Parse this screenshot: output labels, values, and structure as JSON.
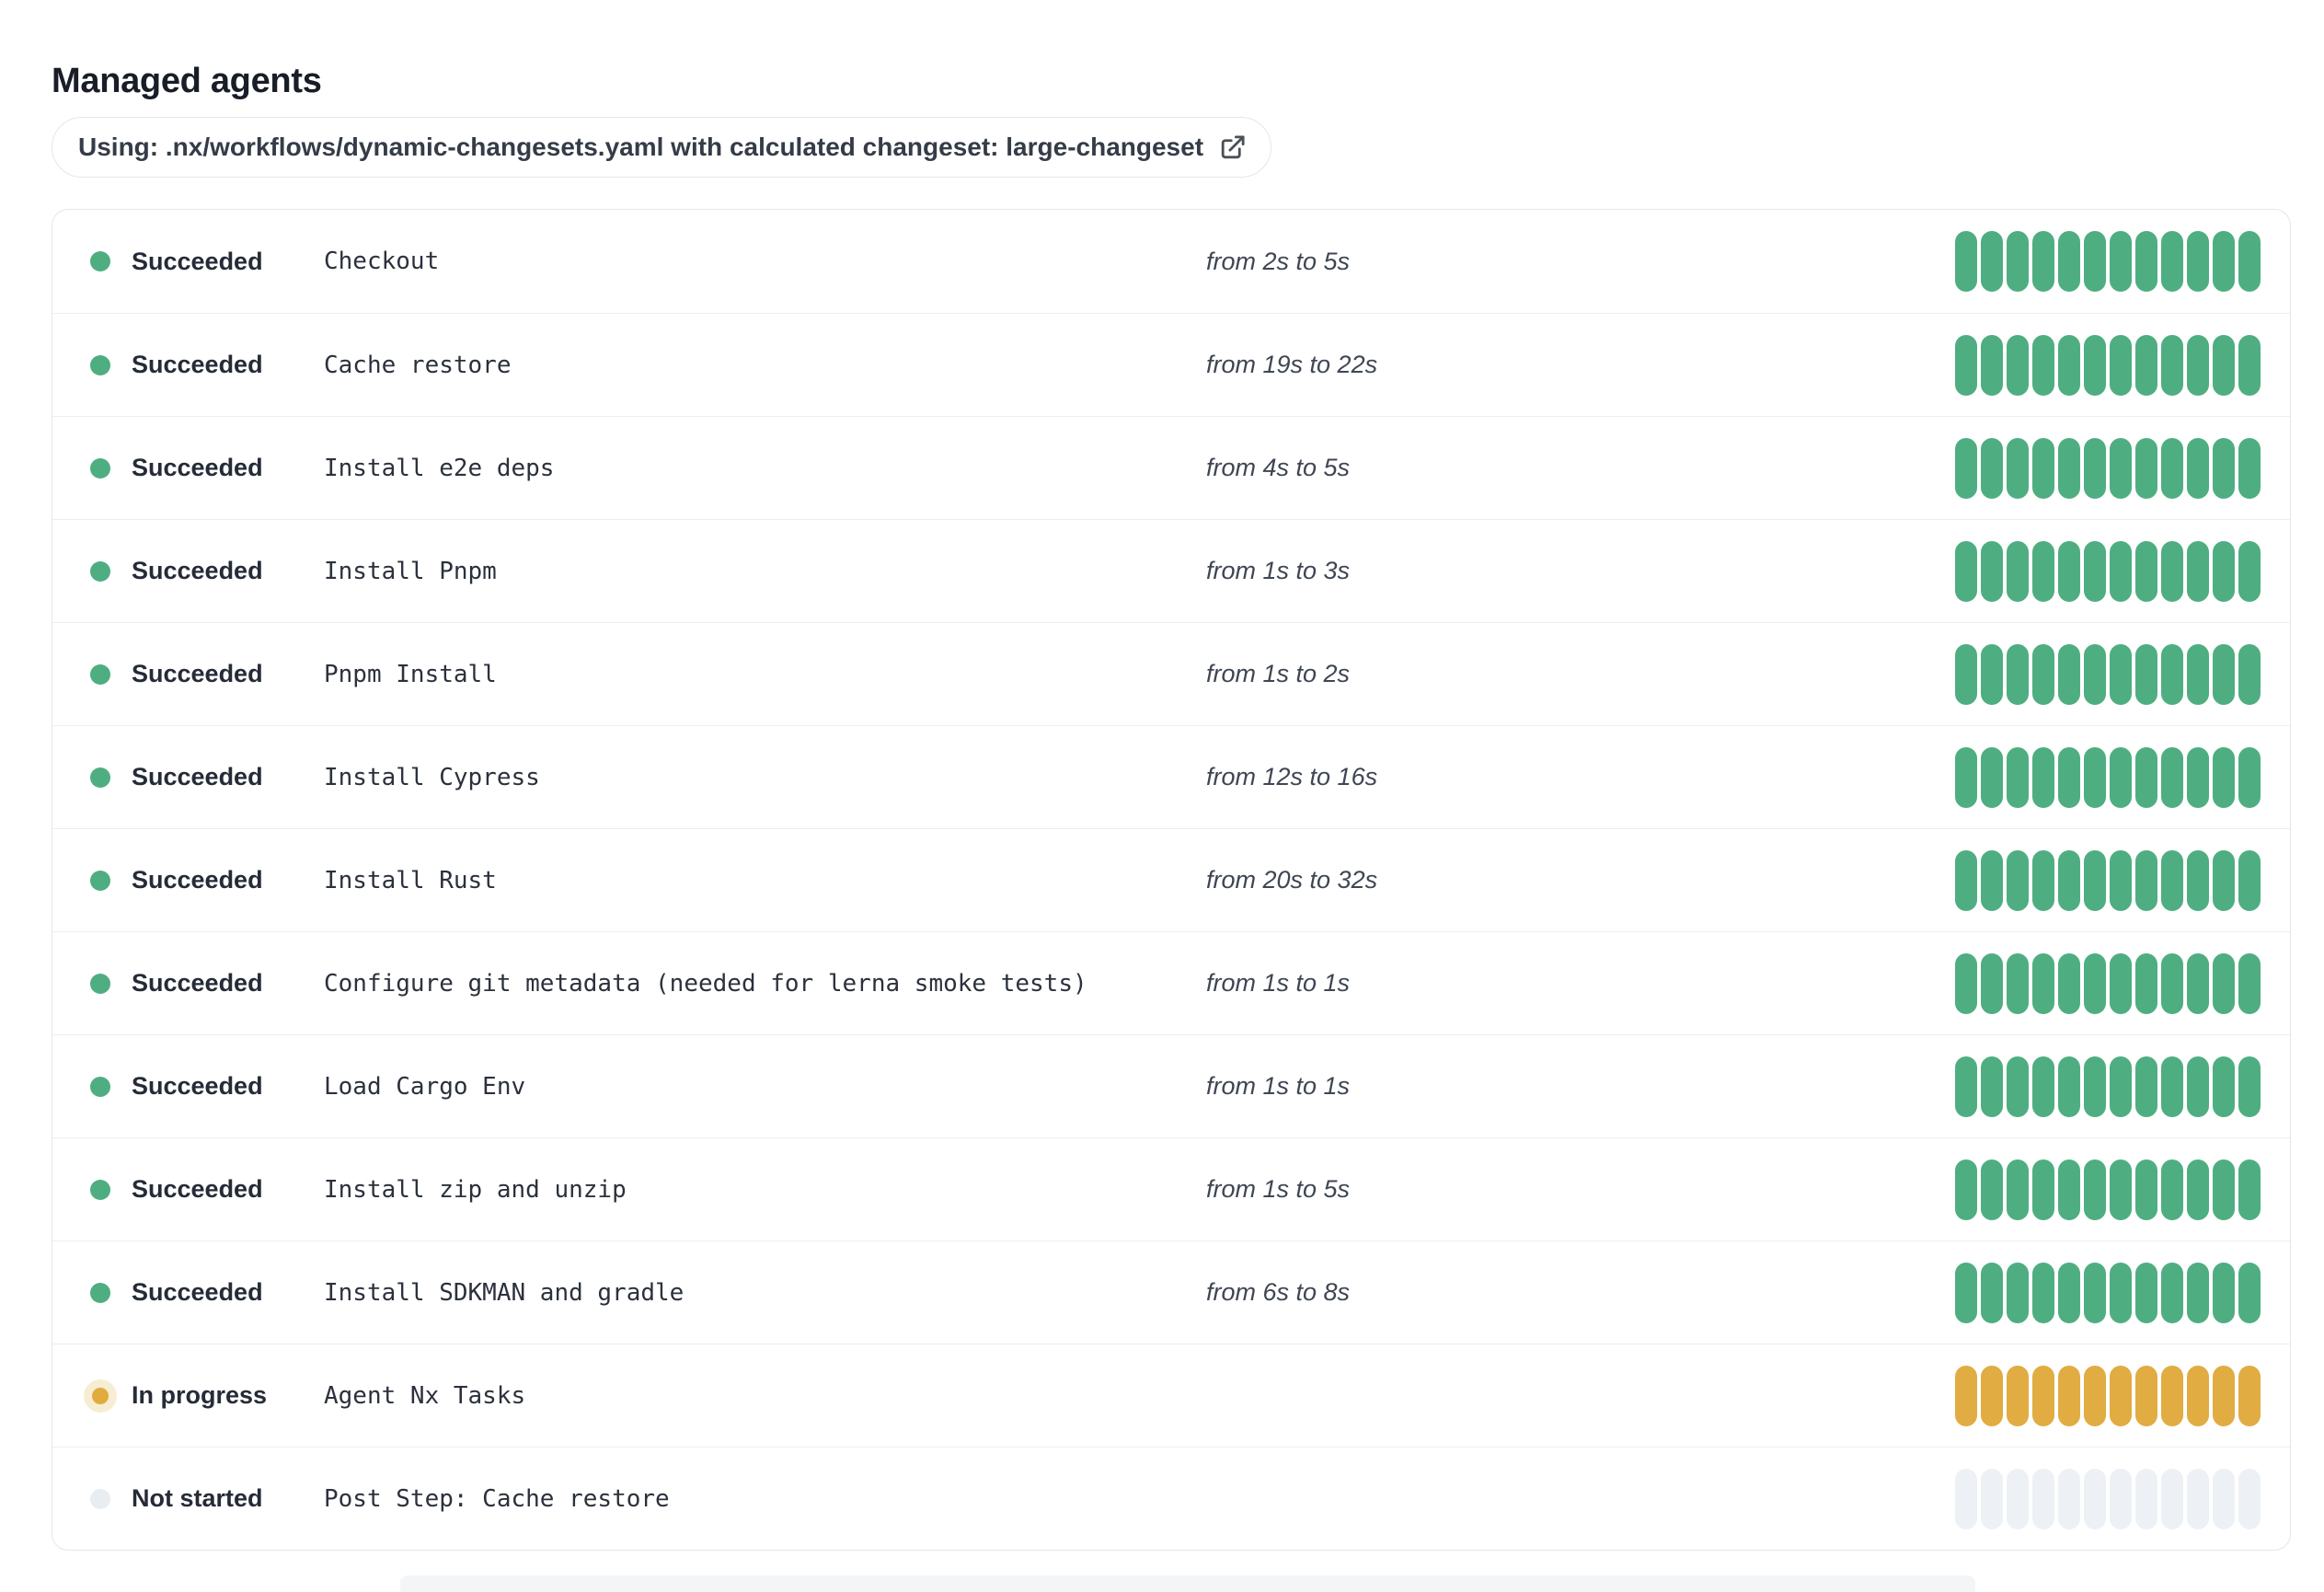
{
  "page": {
    "title": "Managed agents"
  },
  "banner": {
    "label": "Using: .nx/workflows/dynamic-changesets.yaml with calculated changeset: large-changeset",
    "icon": "external-link-icon"
  },
  "agents_bar": {
    "segment_count": 12
  },
  "colors": {
    "succeeded": "#4FAE81",
    "in_progress": "#E1AC42",
    "in_progress_halo": "#F7EDD3",
    "not_started_segment": "#EDF1F5",
    "not_started_dot": "#E8EDF2",
    "status_text": "#252B37",
    "time_text": "#3F4653",
    "card_border": "#E3E6EB"
  },
  "steps": [
    {
      "status": "Succeeded",
      "state": "succeeded",
      "name": "Checkout",
      "time": "from 2s to 5s"
    },
    {
      "status": "Succeeded",
      "state": "succeeded",
      "name": "Cache restore",
      "time": "from 19s to 22s"
    },
    {
      "status": "Succeeded",
      "state": "succeeded",
      "name": "Install e2e deps",
      "time": "from 4s to 5s"
    },
    {
      "status": "Succeeded",
      "state": "succeeded",
      "name": "Install Pnpm",
      "time": "from 1s to 3s"
    },
    {
      "status": "Succeeded",
      "state": "succeeded",
      "name": "Pnpm Install",
      "time": "from 1s to 2s"
    },
    {
      "status": "Succeeded",
      "state": "succeeded",
      "name": "Install Cypress",
      "time": "from 12s to 16s"
    },
    {
      "status": "Succeeded",
      "state": "succeeded",
      "name": "Install Rust",
      "time": "from 20s to 32s"
    },
    {
      "status": "Succeeded",
      "state": "succeeded",
      "name": "Configure git metadata (needed for lerna smoke tests)",
      "time": "from 1s to 1s"
    },
    {
      "status": "Succeeded",
      "state": "succeeded",
      "name": "Load Cargo Env",
      "time": "from 1s to 1s"
    },
    {
      "status": "Succeeded",
      "state": "succeeded",
      "name": "Install zip and unzip",
      "time": "from 1s to 5s"
    },
    {
      "status": "Succeeded",
      "state": "succeeded",
      "name": "Install SDKMAN and gradle",
      "time": "from 6s to 8s"
    },
    {
      "status": "In progress",
      "state": "in_progress",
      "name": "Agent Nx Tasks",
      "time": ""
    },
    {
      "status": "Not started",
      "state": "not_started",
      "name": "Post Step: Cache restore",
      "time": ""
    }
  ]
}
